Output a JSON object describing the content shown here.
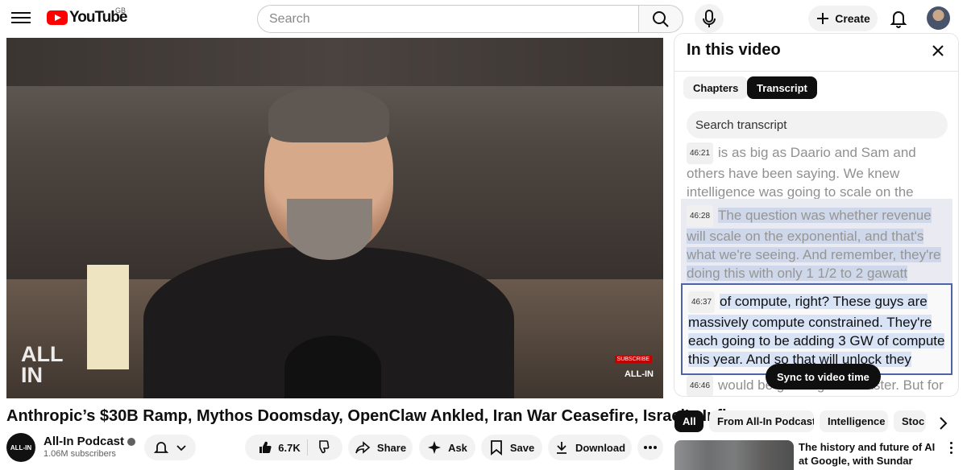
{
  "header": {
    "logo_text": "YouTube",
    "region": "GB",
    "search_placeholder": "Search",
    "create_label": "Create"
  },
  "video": {
    "watermark_left": "ALL\nIN",
    "watermark_right": "ALL-IN",
    "subscribe_overlay": "SUBSCRIBE",
    "title": "Anthropic’s $30B Ramp, Mythos Doomsday, OpenClaw Ankled, Iran War Ceasefire, Israel's Influence"
  },
  "channel": {
    "avatar_text": "ALL-IN",
    "name": "All-In Podcast",
    "subscribers": "1.06M subscribers"
  },
  "actions": {
    "like_count": "6.7K",
    "share_label": "Share",
    "ask_label": "Ask",
    "save_label": "Save",
    "download_label": "Download"
  },
  "panel": {
    "title": "In this video",
    "tabs": [
      {
        "label": "Chapters",
        "active": false
      },
      {
        "label": "Transcript",
        "active": true
      }
    ],
    "search_placeholder": "Search transcript",
    "segments": [
      {
        "time": "46:21",
        "text": "is as big as Daario and Sam and others have been saying. We knew intelligence was going to scale on the exponential."
      },
      {
        "time": "46:28",
        "text": "The question was whether revenue will scale on the exponential, and that's what we're seeing. And remember, they're doing this with only 1 1/2 to 2 gawatt"
      },
      {
        "time": "46:37",
        "text": "of compute, right? These guys are massively compute constrained. They're each going to be adding 3 GW of compute this year. And so that will unlock they"
      },
      {
        "time": "46:46",
        "text": "would be growing even faster. But for that and there is one other thing that I"
      }
    ],
    "sync_label": "Sync to video time"
  },
  "chips": [
    {
      "label": "All",
      "active": true
    },
    {
      "label": "From All-In Podcast",
      "active": false
    },
    {
      "label": "Intelligence",
      "active": false
    },
    {
      "label": "Stoc",
      "active": false
    }
  ],
  "recommendation": {
    "title": "The history and future of AI at Google, with Sundar Pichai"
  },
  "colors": {
    "brand_red": "#ff0000",
    "selection_blue": "#cfd8ea",
    "current_border": "#4d64a6"
  }
}
